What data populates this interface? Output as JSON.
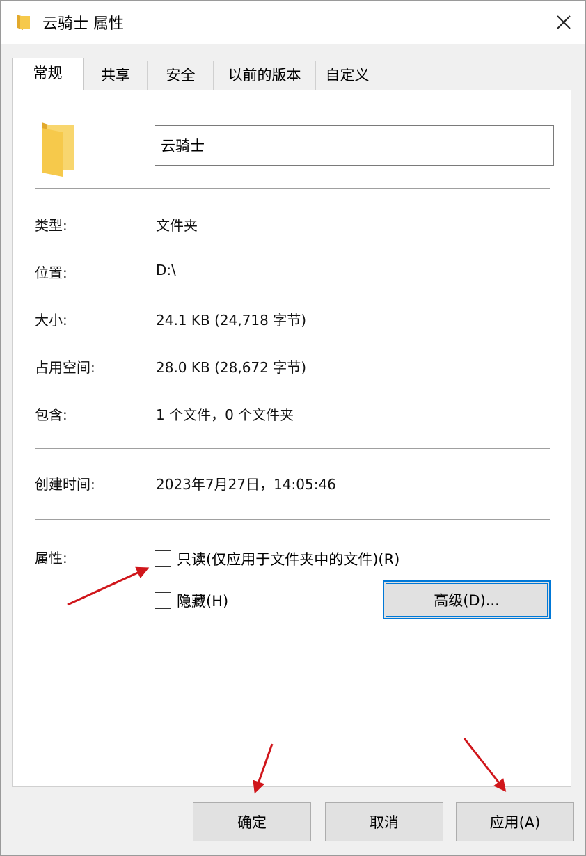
{
  "window": {
    "title": "云骑士 属性",
    "close_icon": "close-icon"
  },
  "tabs": [
    {
      "label": "常规",
      "active": true
    },
    {
      "label": "共享",
      "active": false
    },
    {
      "label": "安全",
      "active": false
    },
    {
      "label": "以前的版本",
      "active": false
    },
    {
      "label": "自定义",
      "active": false
    }
  ],
  "general": {
    "folder_icon": "folder-icon",
    "name_value": "云骑士",
    "type_label": "类型:",
    "type_value": "文件夹",
    "location_label": "位置:",
    "location_value": "D:\\",
    "size_label": "大小:",
    "size_value": "24.1 KB (24,718 字节)",
    "disk_size_label": "占用空间:",
    "disk_size_value": "28.0 KB (28,672 字节)",
    "contains_label": "包含:",
    "contains_value": "1 个文件，0 个文件夹",
    "created_label": "创建时间:",
    "created_value": "2023年7月27日，14:05:46",
    "attributes_label": "属性:",
    "readonly_label": "只读(仅应用于文件夹中的文件)(R)",
    "readonly_checked": false,
    "hidden_label": "隐藏(H)",
    "hidden_checked": false,
    "advanced_button": "高级(D)..."
  },
  "footer": {
    "ok_button": "确定",
    "cancel_button": "取消",
    "apply_button": "应用(A)"
  },
  "colors": {
    "accent": "#0078d7",
    "annotation_arrow": "#d0161b",
    "folder": "#f6c94b"
  }
}
